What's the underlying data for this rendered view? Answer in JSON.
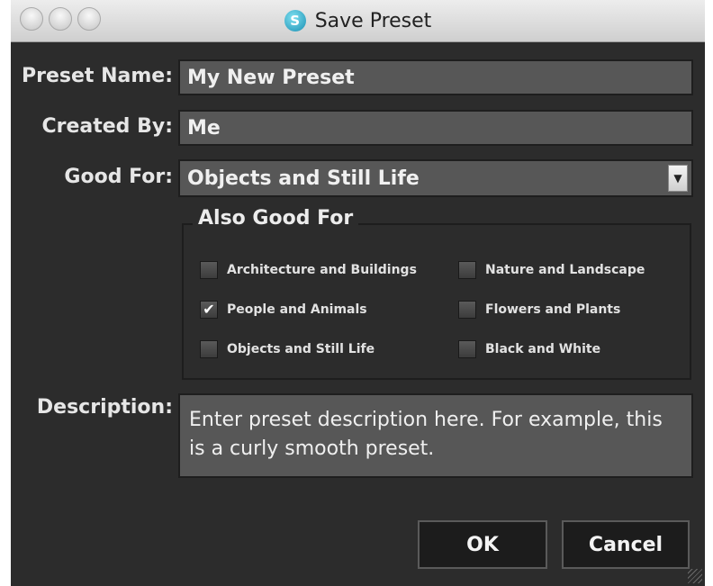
{
  "window": {
    "title": "Save Preset",
    "app_icon_glyph": "S"
  },
  "form": {
    "preset_name_label": "Preset Name:",
    "preset_name_value": "My New Preset",
    "created_by_label": "Created By:",
    "created_by_value": "Me",
    "good_for_label": "Good For:",
    "good_for_value": "Objects and Still Life",
    "dropdown_arrow": "▼"
  },
  "also_good_for": {
    "title": "Also Good For",
    "options": [
      {
        "label": "Architecture and Buildings",
        "checked": false,
        "mark": ""
      },
      {
        "label": "Nature and Landscape",
        "checked": false,
        "mark": ""
      },
      {
        "label": "People and Animals",
        "checked": true,
        "mark": "✔"
      },
      {
        "label": "Flowers and Plants",
        "checked": false,
        "mark": ""
      },
      {
        "label": "Objects and Still Life",
        "checked": false,
        "mark": ""
      },
      {
        "label": "Black and White",
        "checked": false,
        "mark": ""
      }
    ]
  },
  "description": {
    "label": "Description:",
    "value": "Enter preset description here. For example, this is a curly smooth preset."
  },
  "buttons": {
    "ok": "OK",
    "cancel": "Cancel"
  },
  "colors": {
    "window_bg": "#2c2c2c",
    "field_bg": "#575757",
    "button_bg": "#1c1c1c"
  }
}
